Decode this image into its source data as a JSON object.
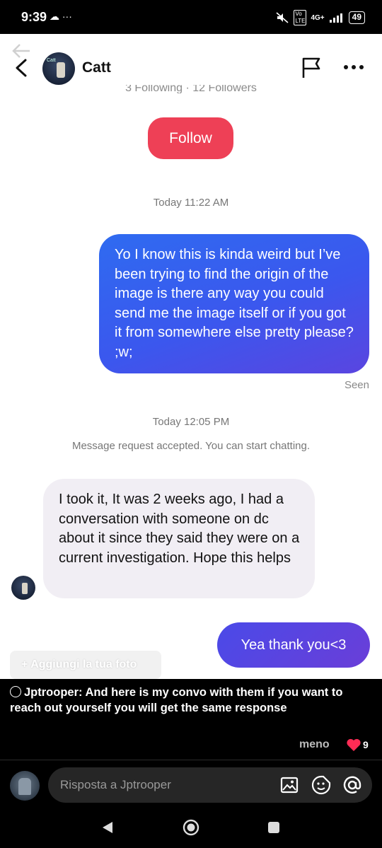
{
  "status_bar": {
    "time": "9:39",
    "left_icons": "☁ ···",
    "network": "4G+",
    "battery": "49"
  },
  "header": {
    "contact_name": "Catt",
    "avatar_tag": "Catt"
  },
  "profile": {
    "follow_counts": "3 Following · 12 Followers",
    "follow_button": "Follow"
  },
  "messages": {
    "timestamp_1": "Today 11:22 AM",
    "outgoing_1": "Yo I know this is kinda weird but I’ve been trying to find the origin of the image is there any way you could send me the image itself or if you got it from somewhere else pretty please? ;w;",
    "seen": "Seen",
    "timestamp_2": "Today 12:05 PM",
    "notice": "Message request accepted. You can start chatting.",
    "incoming_1": "I took it, It was 2 weeks ago, I had a conversation with someone on dc about it since they said they were on a current investigation. Hope this helps",
    "outgoing_2": "Yea thank you<3"
  },
  "overlay": {
    "add_photo": "+ Aggiungi la tua foto"
  },
  "comment": {
    "author": "Jptrooper",
    "text": ": And here is my convo with them if you want to reach out yourself you will get the same response",
    "less_label": "meno",
    "like_count": "9"
  },
  "reply": {
    "placeholder": "Risposta a Jptrooper"
  },
  "colors": {
    "follow": "#ee4056",
    "outgoing_bubble": "#3b57ee",
    "incoming_bubble": "#f1eef4",
    "like": "#fe2c55"
  },
  "icons": [
    "back-arrow-icon",
    "flag-icon",
    "more-icon",
    "image-icon",
    "emoji-icon",
    "at-icon",
    "heart-icon",
    "nav-back-icon",
    "nav-home-icon",
    "nav-recent-icon"
  ]
}
